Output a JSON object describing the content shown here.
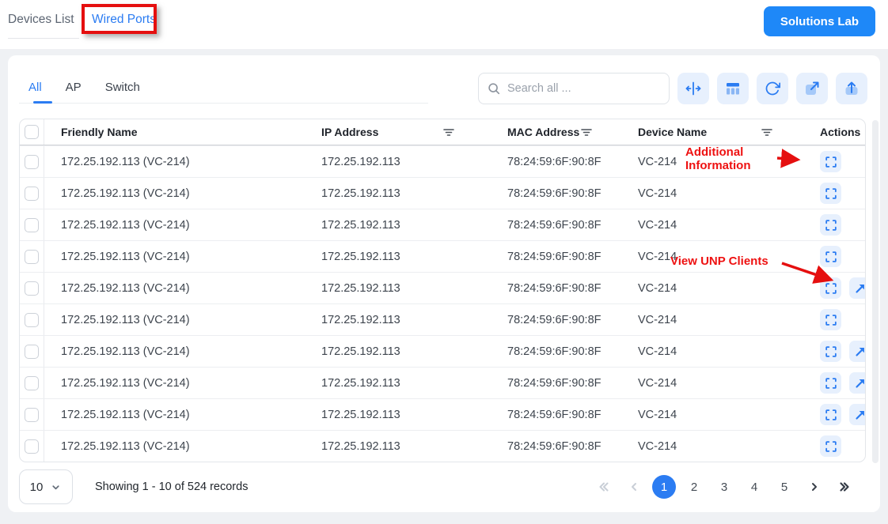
{
  "header": {
    "tabs": [
      {
        "label": "Devices List",
        "active": false
      },
      {
        "label": "Wired Ports",
        "active": true
      }
    ],
    "solutions_button": "Solutions Lab"
  },
  "toolbar": {
    "filter_tabs": [
      {
        "label": "All",
        "active": true
      },
      {
        "label": "AP",
        "active": false
      },
      {
        "label": "Switch",
        "active": false
      }
    ],
    "search_placeholder": "Search all ...",
    "icons": [
      "fit-width",
      "columns",
      "refresh",
      "open-external",
      "upload"
    ]
  },
  "table": {
    "columns": [
      "Friendly Name",
      "IP Address",
      "MAC Address",
      "Device Name",
      "Actions"
    ],
    "filterable_columns": [
      "IP Address",
      "MAC Address",
      "Device Name"
    ],
    "rows": [
      {
        "friendly_name": "172.25.192.113 (VC-214)",
        "ip_address": "172.25.192.113",
        "mac_address": "78:24:59:6F:90:8F",
        "device_name": "VC-214",
        "unp_clients_arrow": false
      },
      {
        "friendly_name": "172.25.192.113 (VC-214)",
        "ip_address": "172.25.192.113",
        "mac_address": "78:24:59:6F:90:8F",
        "device_name": "VC-214",
        "unp_clients_arrow": false
      },
      {
        "friendly_name": "172.25.192.113 (VC-214)",
        "ip_address": "172.25.192.113",
        "mac_address": "78:24:59:6F:90:8F",
        "device_name": "VC-214",
        "unp_clients_arrow": false
      },
      {
        "friendly_name": "172.25.192.113 (VC-214)",
        "ip_address": "172.25.192.113",
        "mac_address": "78:24:59:6F:90:8F",
        "device_name": "VC-214",
        "unp_clients_arrow": false
      },
      {
        "friendly_name": "172.25.192.113 (VC-214)",
        "ip_address": "172.25.192.113",
        "mac_address": "78:24:59:6F:90:8F",
        "device_name": "VC-214",
        "unp_clients_arrow": true
      },
      {
        "friendly_name": "172.25.192.113 (VC-214)",
        "ip_address": "172.25.192.113",
        "mac_address": "78:24:59:6F:90:8F",
        "device_name": "VC-214",
        "unp_clients_arrow": false
      },
      {
        "friendly_name": "172.25.192.113 (VC-214)",
        "ip_address": "172.25.192.113",
        "mac_address": "78:24:59:6F:90:8F",
        "device_name": "VC-214",
        "unp_clients_arrow": true
      },
      {
        "friendly_name": "172.25.192.113 (VC-214)",
        "ip_address": "172.25.192.113",
        "mac_address": "78:24:59:6F:90:8F",
        "device_name": "VC-214",
        "unp_clients_arrow": true
      },
      {
        "friendly_name": "172.25.192.113 (VC-214)",
        "ip_address": "172.25.192.113",
        "mac_address": "78:24:59:6F:90:8F",
        "device_name": "VC-214",
        "unp_clients_arrow": true
      },
      {
        "friendly_name": "172.25.192.113 (VC-214)",
        "ip_address": "172.25.192.113",
        "mac_address": "78:24:59:6F:90:8F",
        "device_name": "VC-214",
        "unp_clients_arrow": false
      }
    ]
  },
  "annotations": {
    "highlighted_tab": "Wired Ports",
    "additional_information": "Additional Information",
    "view_unp_clients": "View UNP Clients",
    "color": "#e50f0f"
  },
  "pagination": {
    "page_size": "10",
    "summary": "Showing 1 - 10 of 524 records",
    "pages": [
      "1",
      "2",
      "3",
      "4",
      "5"
    ],
    "current_page": "1"
  },
  "colors": {
    "accent_blue": "#2b7cf2",
    "button_blue": "#1e88f8",
    "icon_bg_blue": "#e7f0fd",
    "annotation_red": "#e50f0f"
  }
}
